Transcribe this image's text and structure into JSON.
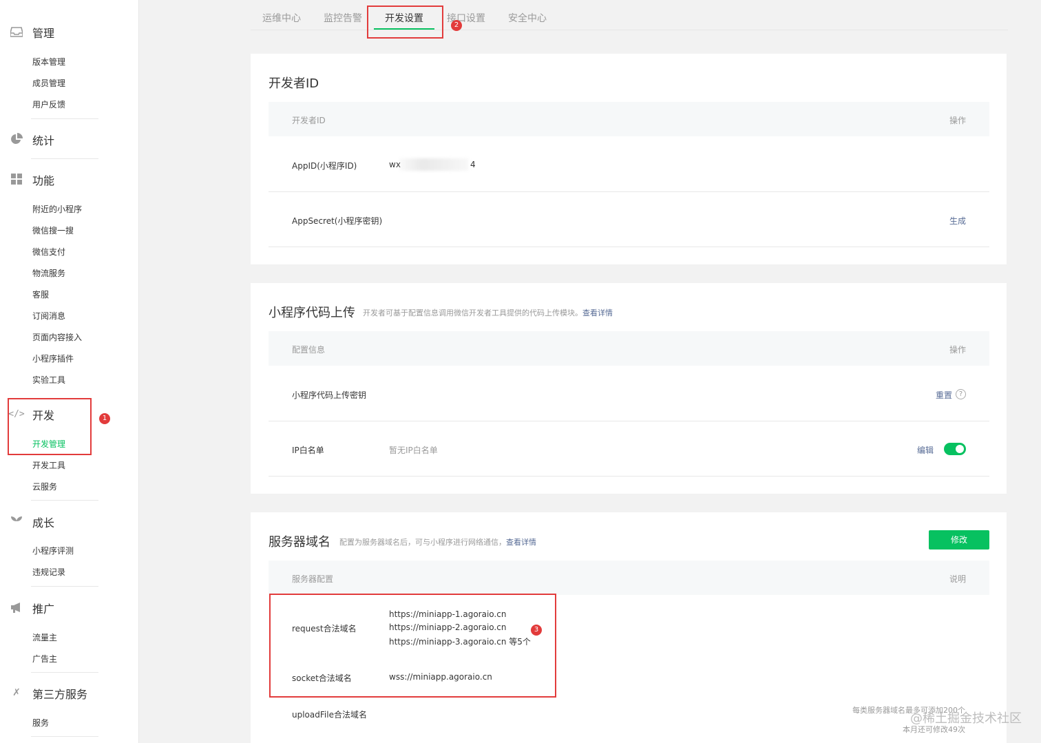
{
  "sidebar": {
    "groups": [
      {
        "label": "管理",
        "icon": "inbox-icon",
        "items": [
          "版本管理",
          "成员管理",
          "用户反馈"
        ]
      },
      {
        "label": "统计",
        "icon": "pie-chart-icon",
        "items": []
      },
      {
        "label": "功能",
        "icon": "grid-icon",
        "items": [
          "附近的小程序",
          "微信搜一搜",
          "微信支付",
          "物流服务",
          "客服",
          "订阅消息",
          "页面内容接入",
          "小程序插件",
          "实验工具"
        ]
      },
      {
        "label": "开发",
        "icon": "code-icon",
        "items": [
          "开发管理",
          "开发工具",
          "云服务"
        ],
        "active_item": "开发管理"
      },
      {
        "label": "成长",
        "icon": "sprout-icon",
        "items": [
          "小程序评测",
          "违规记录"
        ]
      },
      {
        "label": "推广",
        "icon": "megaphone-icon",
        "items": [
          "流量主",
          "广告主"
        ]
      },
      {
        "label": "第三方服务",
        "icon": "third-party-icon",
        "items": [
          "服务"
        ]
      }
    ]
  },
  "tabs": [
    "运维中心",
    "监控告警",
    "开发设置",
    "接口设置",
    "安全中心"
  ],
  "active_tab": "开发设置",
  "annotations": [
    "1",
    "2",
    "3"
  ],
  "developer_id": {
    "title": "开发者ID",
    "header_left": "开发者ID",
    "header_right": "操作",
    "appid_label": "AppID(小程序ID)",
    "appid_prefix": "wx",
    "appid_suffix": "4",
    "secret_label": "AppSecret(小程序密钥)",
    "secret_action": "生成"
  },
  "code_upload": {
    "title": "小程序代码上传",
    "desc": "开发者可基于配置信息调用微信开发者工具提供的代码上传模块。",
    "desc_link": "查看详情",
    "header_left": "配置信息",
    "header_right": "操作",
    "key_label": "小程序代码上传密钥",
    "key_action": "重置",
    "ip_label": "IP白名单",
    "ip_value": "暂无IP白名单",
    "ip_action": "编辑",
    "ip_toggle_on": true
  },
  "server_domain": {
    "title": "服务器域名",
    "desc": "配置为服务器域名后，可与小程序进行网络通信，",
    "desc_link": "查看详情",
    "modify_button": "修改",
    "header_left": "服务器配置",
    "header_right": "说明",
    "request_label": "request合法域名",
    "request_values": [
      "https://miniapp-1.agoraio.cn",
      "https://miniapp-2.agoraio.cn",
      "https://miniapp-3.agoraio.cn 等5个"
    ],
    "socket_label": "socket合法域名",
    "socket_value": "wss://miniapp.agoraio.cn",
    "upload_label": "uploadFile合法域名",
    "note_line1": "每类服务器域名最多可添加200个",
    "note_line2": "本月还可修改49次"
  },
  "watermark": "@稀土掘金技术社区",
  "colors": {
    "accent": "#07c160",
    "link": "#576b95",
    "annotation": "#e23b3b"
  }
}
